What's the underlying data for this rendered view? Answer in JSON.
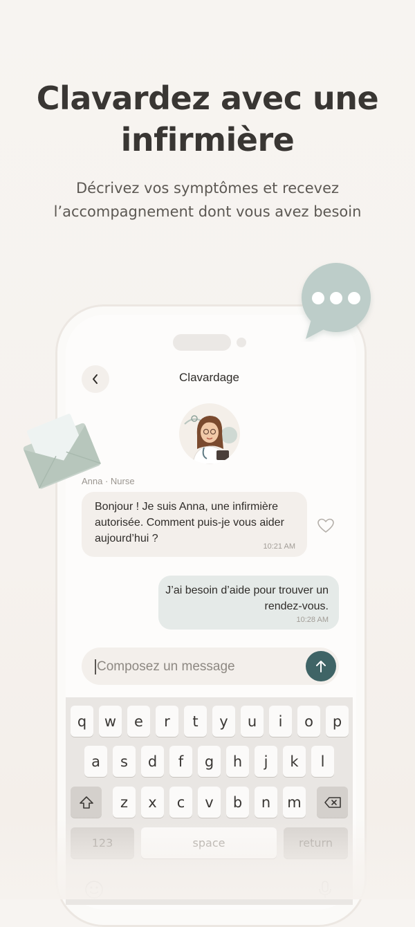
{
  "headline": {
    "line1": "Clavardez avec une",
    "line2": "infirmière"
  },
  "subhead": {
    "line1": "Décrivez vos symptômes et recevez",
    "line2": "l’accompagnement dont vous avez besoin"
  },
  "chat": {
    "title": "Clavardage",
    "back_icon": "chevron-left-icon",
    "sender": "Anna · Nurse",
    "incoming": {
      "text": "Bonjour ! Je suis Anna, une infirmière autorisée. Comment puis-je vous aider aujourd’hui ?",
      "time": "10:21 AM"
    },
    "outgoing": {
      "text": "J’ai besoin d’aide pour trouver un rendez-vous.",
      "time": "10:28 AM"
    },
    "composer": {
      "placeholder": "Composez un message",
      "send_icon": "arrow-up-icon"
    }
  },
  "keyboard": {
    "row1": [
      "q",
      "w",
      "e",
      "r",
      "t",
      "y",
      "u",
      "i",
      "o",
      "p"
    ],
    "row2": [
      "a",
      "s",
      "d",
      "f",
      "g",
      "h",
      "j",
      "k",
      "l"
    ],
    "row3": [
      "z",
      "x",
      "c",
      "v",
      "b",
      "n",
      "m"
    ],
    "numbers": "123",
    "space": "space",
    "return": "return"
  },
  "colors": {
    "accent": "#3f6466",
    "incoming_bubble": "#f3efeb",
    "outgoing_bubble": "#e5eae8",
    "background": "#f7f4f1"
  }
}
